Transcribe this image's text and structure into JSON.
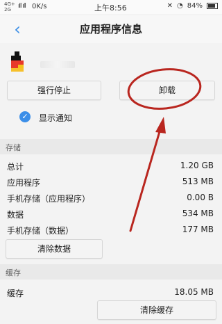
{
  "status_bar": {
    "network_top": "4G+",
    "network_bottom": "2G",
    "signal": "ıll ıll",
    "speed": "0K/s",
    "time": "上午8:56",
    "battery": "84%"
  },
  "header": {
    "title": "应用程序信息"
  },
  "actions": {
    "force_stop": "强行停止",
    "uninstall": "卸载"
  },
  "notification": {
    "label": "显示通知",
    "checked": true
  },
  "storage": {
    "section_title": "存储",
    "rows": [
      {
        "label": "总计",
        "value": "1.20 GB"
      },
      {
        "label": "应用程序",
        "value": "513 MB"
      },
      {
        "label": "手机存储（应用程序）",
        "value": "0.00 B"
      },
      {
        "label": "数据",
        "value": "534 MB"
      },
      {
        "label": "手机存储（数据）",
        "value": "177 MB"
      }
    ],
    "clear_data": "清除数据"
  },
  "cache": {
    "section_title": "缓存",
    "rows": [
      {
        "label": "缓存",
        "value": "18.05 MB"
      }
    ],
    "clear_cache": "清除缓存"
  },
  "colors": {
    "accent": "#3b8ee8",
    "annotation": "#b9261f"
  }
}
